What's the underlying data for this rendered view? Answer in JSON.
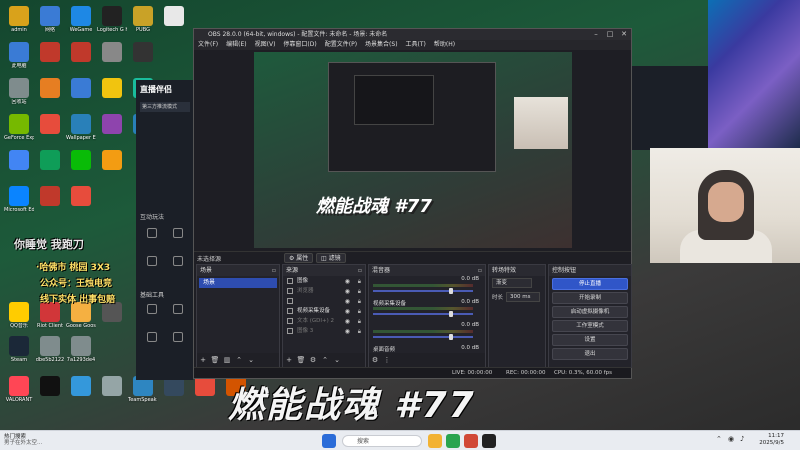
{
  "desktop": {
    "icons": [
      {
        "label": "admin",
        "color": "#d9a21b"
      },
      {
        "label": "网络",
        "color": "#3a7bd5"
      },
      {
        "label": "WeGame",
        "color": "#1e88e5"
      },
      {
        "label": "Logitech G HUB",
        "color": "#222222"
      },
      {
        "label": "PUBG",
        "color": "#c9a227"
      },
      {
        "label": "",
        "color": "#e8e8e8"
      },
      {
        "label": "此电脑",
        "color": "#3a7bd5"
      },
      {
        "label": "",
        "color": "#c0392b"
      },
      {
        "label": "",
        "color": "#c0392b"
      },
      {
        "label": "",
        "color": "#888888"
      },
      {
        "label": "",
        "color": "#333333"
      },
      {
        "label": "回收站",
        "color": "#7f8c8d"
      },
      {
        "label": "",
        "color": "#e67e22"
      },
      {
        "label": "",
        "color": "#3a7bd5"
      },
      {
        "label": "",
        "color": "#f1c40f"
      },
      {
        "label": "",
        "color": "#1abc9c"
      },
      {
        "label": "GeForce Experience",
        "color": "#76b900"
      },
      {
        "label": "",
        "color": "#e74c3c"
      },
      {
        "label": "Wallpaper Engine",
        "color": "#2980b9"
      },
      {
        "label": "",
        "color": "#8e44ad"
      },
      {
        "label": "",
        "color": "#2980b9"
      },
      {
        "label": "",
        "color": "#4285f4"
      },
      {
        "label": "",
        "color": "#0f9d58"
      },
      {
        "label": "",
        "color": "#09bb07"
      },
      {
        "label": "",
        "color": "#f39c12"
      },
      {
        "label": "Microsoft Edge",
        "color": "#0a84ff"
      },
      {
        "label": "",
        "color": "#c0392b"
      },
      {
        "label": "",
        "color": "#e74c3c"
      },
      {
        "label": "QQ音乐",
        "color": "#ffcc00"
      },
      {
        "label": "Riot Client",
        "color": "#d13639"
      },
      {
        "label": "Goose Goose Duck",
        "color": "#f5b041"
      },
      {
        "label": "",
        "color": "#555555"
      },
      {
        "label": "Steam",
        "color": "#1b2838"
      },
      {
        "label": "dbe5b2122",
        "color": "#7f8c8d"
      },
      {
        "label": "7a1293de4",
        "color": "#7f8c8d"
      },
      {
        "label": "VALORANT",
        "color": "#ff4655"
      },
      {
        "label": "",
        "color": "#111111"
      },
      {
        "label": "",
        "color": "#3498db"
      },
      {
        "label": "",
        "color": "#95a5a6"
      },
      {
        "label": "TeamSpeak 3",
        "color": "#2e86c1"
      },
      {
        "label": "",
        "color": "#34495e"
      },
      {
        "label": "",
        "color": "#e74c3c"
      },
      {
        "label": "",
        "color": "#d35400"
      }
    ],
    "overlay_lines": [
      {
        "text": "你睡觉  我跑刀",
        "color": "#ffffff"
      },
      {
        "text": "·哈佛市  桃园 3X3",
        "color": "#ffe066"
      },
      {
        "text": "公众号：王烛电竞",
        "color": "#ffe066"
      },
      {
        "text": "线下实体 出事包赔",
        "color": "#ffe066"
      }
    ],
    "big_overlay": "燃能战魂 #77"
  },
  "app_panel": {
    "brand": "直播伴侣",
    "mode": "第三方推流模式",
    "section_interact": "互动玩法",
    "section_tools": "基础工具",
    "tools": [
      "",
      "",
      "",
      "",
      "",
      ""
    ]
  },
  "obs": {
    "title": "OBS 28.0.0 (64-bit, windows) - 配置文件: 未命名 - 场景: 未命名",
    "menu": [
      "文件(F)",
      "编辑(E)",
      "视图(V)",
      "停靠窗口(D)",
      "配置文件(P)",
      "场景集合(S)",
      "工具(T)",
      "帮助(H)"
    ],
    "preview_big_text": "燃能战魂 #77",
    "scene_bar": {
      "label": "未选择源",
      "props_btn": "属性",
      "filters_btn": "滤镜"
    },
    "scenes": {
      "header": "场景",
      "items": [
        "场景"
      ]
    },
    "sources": {
      "header": "来源",
      "items": [
        {
          "label": "图像",
          "dim": false
        },
        {
          "label": "浏览器",
          "dim": true
        },
        {
          "label": "",
          "dim": false
        },
        {
          "label": "视频采集设备",
          "dim": false
        },
        {
          "label": "文本 (GDI+) 2",
          "dim": true
        },
        {
          "label": "图像 3",
          "dim": true
        }
      ]
    },
    "mixer": {
      "header": "混音器",
      "channels": [
        {
          "name": "",
          "db": "0.0 dB",
          "level": 0.78
        },
        {
          "name": "视频采集设备",
          "db": "0.0 dB",
          "level": 0.78
        },
        {
          "name": "",
          "db": "0.0 dB",
          "level": 0.78
        },
        {
          "name": "桌面音频",
          "db": "0.0 dB",
          "level": 0.78
        }
      ]
    },
    "transitions": {
      "header": "转场特效",
      "type": "渐变",
      "duration_label": "时长",
      "duration": "300 ms"
    },
    "controls": {
      "header": "控制按钮",
      "buttons": [
        "停止直播",
        "开始录制",
        "启动虚拟摄像机",
        "工作室模式",
        "设置",
        "退出"
      ]
    },
    "status": {
      "live": "LIVE: 00:00:00",
      "rec": "REC: 00:00:00",
      "perf": "CPU: 0.3%, 60.00 fps"
    }
  },
  "taskbar": {
    "news_title": "热门搜索",
    "news_sub": "男子在外太空...",
    "search_placeholder": "搜索",
    "time": "11:17",
    "date": "2025/9/5"
  }
}
